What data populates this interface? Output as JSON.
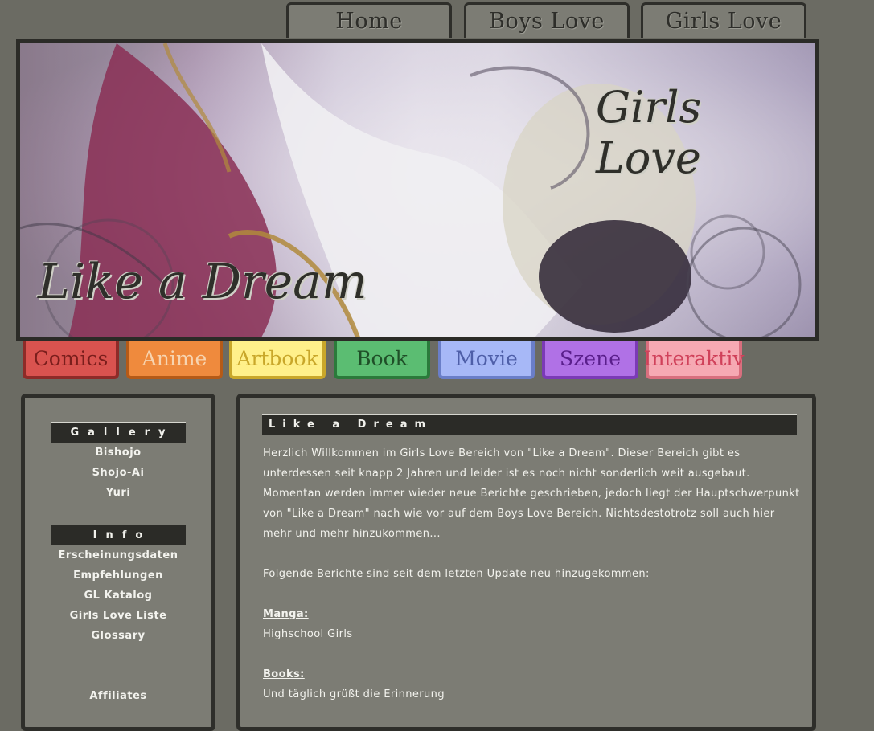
{
  "top_nav": [
    {
      "label": "Home"
    },
    {
      "label": "Boys Love"
    },
    {
      "label": "Girls Love"
    }
  ],
  "banner": {
    "title_left": "Like a Dream",
    "title_right": "Girls Love"
  },
  "categories": [
    {
      "label": "Comics",
      "bg": "#d9534f",
      "border": "#8e2b28",
      "fg": "#7a1e1c"
    },
    {
      "label": "Anime",
      "bg": "#ef8a3d",
      "border": "#b55a17",
      "fg": "#f7d4b0"
    },
    {
      "label": "Artbook",
      "bg": "#fff08a",
      "border": "#c9a72a",
      "fg": "#c9a72a"
    },
    {
      "label": "Book",
      "bg": "#5bbd72",
      "border": "#2b7a3b",
      "fg": "#1f4f28"
    },
    {
      "label": "Movie",
      "bg": "#a7b8f7",
      "border": "#6a7ec8",
      "fg": "#4e5ea8"
    },
    {
      "label": "Szene",
      "bg": "#b071e6",
      "border": "#7b3ab6",
      "fg": "#5a1f8c"
    },
    {
      "label": "Interaktiv",
      "bg": "#f6a9b3",
      "border": "#d86f7e",
      "fg": "#d0415a"
    }
  ],
  "sidebar": {
    "gallery_title": "Gallery",
    "gallery_links": [
      "Bishojo",
      "Shojo-Ai",
      "Yuri"
    ],
    "info_title": "Info",
    "info_links": [
      "Erscheinungsdaten",
      "Empfehlungen",
      "GL Katalog",
      "Girls Love Liste",
      "Glossary"
    ],
    "affiliates_label": "Affiliates"
  },
  "content": {
    "title": "Like a Dream",
    "intro_lines": [
      "Herzlich Willkommen im Girls Love Bereich von \"Like a Dream\". Dieser Bereich gibt es",
      "unterdessen seit knapp 2 Jahren und leider ist es noch nicht sonderlich weit ausgebaut.",
      "Momentan werden immer wieder neue Berichte geschrieben, jedoch liegt der Hauptschwerpunkt",
      "von \"Like a Dream\" nach wie vor auf dem Boys Love Bereich. Nichtsdestotrotz soll auch hier",
      "mehr und mehr hinzukommen..."
    ],
    "update_line": "Folgende Berichte sind seit dem letzten Update neu hinzugekommen:",
    "manga_heading": "Manga:",
    "manga_item": "Highschool Girls",
    "books_heading": "Books:",
    "books_item": "Und täglich grüßt die Erinnerung"
  },
  "colors": {
    "background": "#6b6b63",
    "panel": "#7c7c74",
    "border": "#2e2e2a",
    "text": "#f3f3ee"
  }
}
